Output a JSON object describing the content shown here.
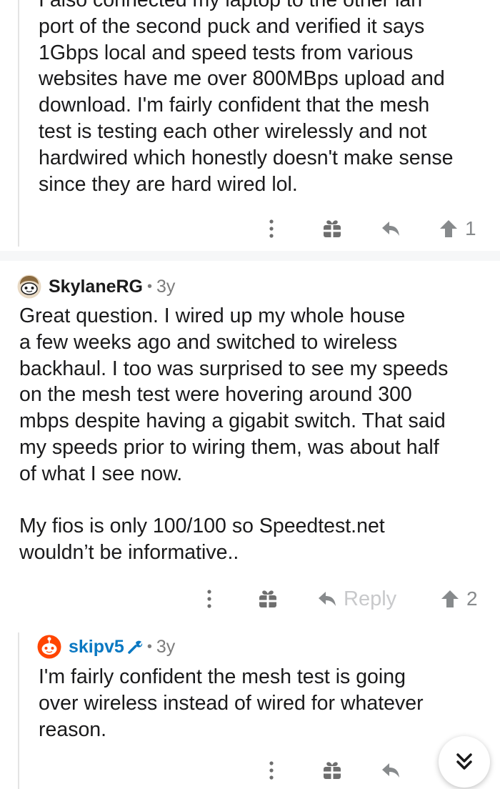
{
  "comments": [
    {
      "body": "I also connected my laptop to the other lan\nport of the second puck and verified it says\n1Gbps local and speed tests from various\nwebsites have me over 800MBps upload and\ndownload. I'm fairly confident that the mesh\ntest is testing each other wirelessly and not\nhardwired which honestly doesn't make sense\nsince they are hard wired lol.",
      "vote_count": "1",
      "reply_label": ""
    },
    {
      "author": "SkylaneRG",
      "age": "3y",
      "body": "Great question. I wired up my whole house\na few weeks ago and switched to wireless\nbackhaul. I too was surprised to see my speeds\non the mesh test were hovering around 300\nmbps despite having a gigabit switch. That said\nmy speeds prior to wiring them, was about half\nof what I see now.\n\nMy fios is only 100/100 so Speedtest.net\nwouldn’t be informative..",
      "vote_count": "2",
      "reply_label": "Reply"
    },
    {
      "author": "skipv5",
      "age": "3y",
      "body": "I'm fairly confident the mesh test is going\nover wireless instead of wired for whatever\nreason.",
      "vote_count": "",
      "reply_label": ""
    }
  ],
  "meta_separator": "•",
  "icons": {
    "more": "more-options-icon",
    "award": "award-gift-icon",
    "reply": "reply-arrow-icon",
    "upvote": "upvote-arrow-icon",
    "scroll": "double-chevron-down-icon",
    "mod": "moderator-wrench-icon"
  },
  "colors": {
    "op_author": "#0a78c2",
    "icon_gray": "#878a8c",
    "avatar_red": "#ff4500"
  }
}
